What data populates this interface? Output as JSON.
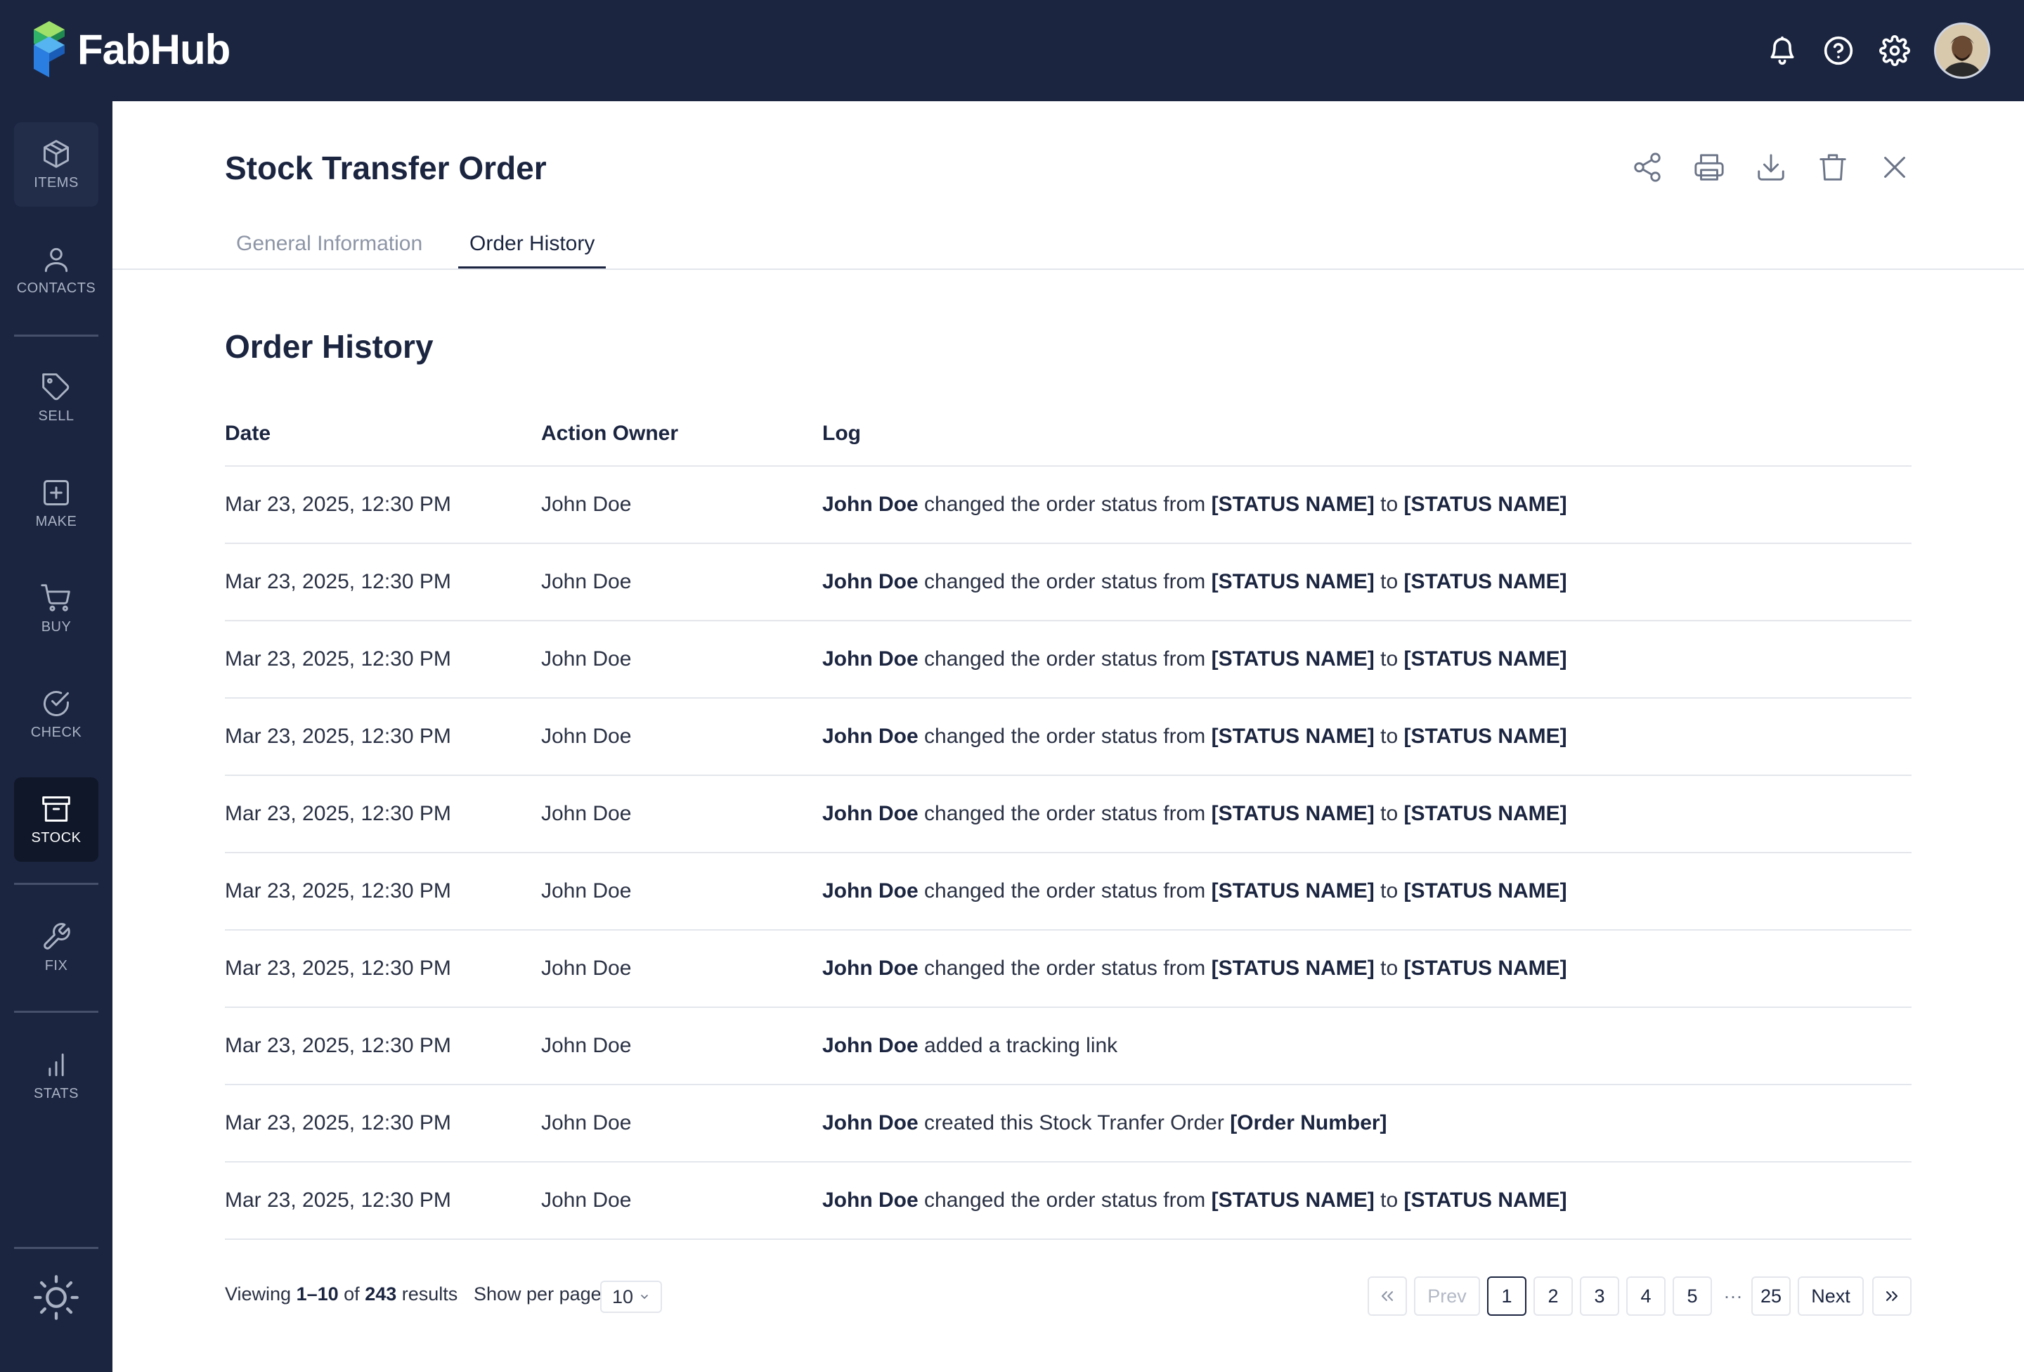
{
  "app": {
    "name": "FabHub"
  },
  "sidebar": {
    "items": [
      {
        "label": "ITEMS",
        "icon": "cube-icon"
      },
      {
        "label": "CONTACTS",
        "icon": "person-icon"
      },
      {
        "label": "SELL",
        "icon": "tag-icon"
      },
      {
        "label": "MAKE",
        "icon": "plus-square-icon"
      },
      {
        "label": "BUY",
        "icon": "cart-icon"
      },
      {
        "label": "CHECK",
        "icon": "check-circle-icon"
      },
      {
        "label": "STOCK",
        "icon": "archive-icon",
        "active": true
      },
      {
        "label": "FIX",
        "icon": "wrench-icon"
      },
      {
        "label": "STATS",
        "icon": "bar-chart-icon"
      }
    ]
  },
  "page": {
    "title": "Stock Transfer Order",
    "tabs": [
      {
        "label": "General Information",
        "active": false
      },
      {
        "label": "Order History",
        "active": true
      }
    ],
    "section_title": "Order History"
  },
  "table": {
    "columns": [
      "Date",
      "Action Owner",
      "Log"
    ],
    "rows": [
      {
        "date": "Mar 23, 2025, 12:30 PM",
        "owner": "John Doe",
        "log": {
          "actor": "John Doe",
          "text1": " changed the order status from ",
          "b1": "[STATUS NAME]",
          "text2": " to ",
          "b2": "[STATUS NAME]"
        }
      },
      {
        "date": "Mar 23, 2025, 12:30 PM",
        "owner": "John Doe",
        "log": {
          "actor": "John Doe",
          "text1": " changed the order status from ",
          "b1": "[STATUS NAME]",
          "text2": " to ",
          "b2": "[STATUS NAME]"
        }
      },
      {
        "date": "Mar 23, 2025, 12:30 PM",
        "owner": "John Doe",
        "log": {
          "actor": "John Doe",
          "text1": " changed the order status from ",
          "b1": "[STATUS NAME]",
          "text2": " to ",
          "b2": "[STATUS NAME]"
        }
      },
      {
        "date": "Mar 23, 2025, 12:30 PM",
        "owner": "John Doe",
        "log": {
          "actor": "John Doe",
          "text1": " changed the order status from ",
          "b1": "[STATUS NAME]",
          "text2": " to ",
          "b2": "[STATUS NAME]"
        }
      },
      {
        "date": "Mar 23, 2025, 12:30 PM",
        "owner": "John Doe",
        "log": {
          "actor": "John Doe",
          "text1": " changed the order status from ",
          "b1": "[STATUS NAME]",
          "text2": " to ",
          "b2": "[STATUS NAME]"
        }
      },
      {
        "date": "Mar 23, 2025, 12:30 PM",
        "owner": "John Doe",
        "log": {
          "actor": "John Doe",
          "text1": " changed the order status from ",
          "b1": "[STATUS NAME]",
          "text2": " to ",
          "b2": "[STATUS NAME]"
        }
      },
      {
        "date": "Mar 23, 2025, 12:30 PM",
        "owner": "John Doe",
        "log": {
          "actor": "John Doe",
          "text1": " changed the order status from ",
          "b1": "[STATUS NAME]",
          "text2": " to ",
          "b2": "[STATUS NAME]"
        }
      },
      {
        "date": "Mar 23, 2025, 12:30 PM",
        "owner": "John Doe",
        "log": {
          "actor": "John Doe",
          "text1": " added a tracking link",
          "b1": "",
          "text2": "",
          "b2": ""
        }
      },
      {
        "date": "Mar 23, 2025, 12:30 PM",
        "owner": "John Doe",
        "log": {
          "actor": "John Doe",
          "text1": " created this Stock Tranfer Order ",
          "b1": "[Order Number]",
          "text2": "",
          "b2": ""
        }
      },
      {
        "date": "Mar 23, 2025, 12:30 PM",
        "owner": "John Doe",
        "log": {
          "actor": "John Doe",
          "text1": " changed the order status from ",
          "b1": "[STATUS NAME]",
          "text2": " to ",
          "b2": "[STATUS NAME]"
        }
      }
    ]
  },
  "footer": {
    "viewing_prefix": "Viewing ",
    "range": "1–10",
    "of_text": " of ",
    "total": "243",
    "results_text": " results",
    "per_page_label": "Show per page",
    "per_page_value": "10"
  },
  "pagination": {
    "prev": "Prev",
    "next": "Next",
    "pages": [
      "1",
      "2",
      "3",
      "4",
      "5"
    ],
    "ellipsis": "···",
    "last": "25",
    "current": "1"
  },
  "colors": {
    "nav_bg": "#1b2540",
    "accent": "#1b2540",
    "border": "#e3e6ec"
  }
}
